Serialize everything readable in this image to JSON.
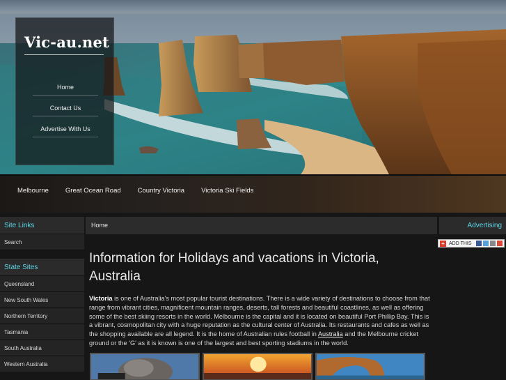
{
  "site": {
    "logo": "Vic-au.net"
  },
  "logo_nav": [
    {
      "label": "Home"
    },
    {
      "label": "Contact Us"
    },
    {
      "label": "Advertise With Us"
    }
  ],
  "top_nav": [
    {
      "label": "Melbourne"
    },
    {
      "label": "Great Ocean Road"
    },
    {
      "label": "Country Victoria"
    },
    {
      "label": "Victoria Ski Fields"
    }
  ],
  "sidebar": {
    "site_links_title": "Site Links",
    "site_links": [
      {
        "label": "Search"
      }
    ],
    "state_sites_title": "State Sites",
    "state_sites": [
      {
        "label": "Queensland"
      },
      {
        "label": "New South Wales"
      },
      {
        "label": "Northern Territory"
      },
      {
        "label": "Tasmania"
      },
      {
        "label": "South Australia"
      },
      {
        "label": "Western Australia"
      }
    ]
  },
  "main": {
    "breadcrumb": "Home",
    "title": "Information for Holidays and vacations in Victoria, Australia",
    "intro_bold": "Victoria",
    "intro_part1": " is one of Australia's most popular tourist destinations. There is a wide variety of destinations to choose from that range from vibrant cities, magnificent mountain ranges, deserts, tall forests and beautiful coastlines, as well as offering some of the best skiing resorts in the world. Melbourne is the capital and it is located on beautiful Port Phillip Bay. This is a vibrant, cosmopolitan city with a huge reputation as the cultural center of Australia. Its restaurants and cafes as well as the shopping available are all legend. It is the home of Australian rules football in ",
    "intro_link": "Australia",
    "intro_part2": " and the Melbourne cricket ground or the 'G' as it is known is one of the largest and best sporting stadiums in the world."
  },
  "right": {
    "advertising_title": "Advertising",
    "addthis_label": "ADD THIS"
  },
  "colors": {
    "accent": "#5dd6e8",
    "panel": "#2b2b2b",
    "background": "#161616"
  }
}
